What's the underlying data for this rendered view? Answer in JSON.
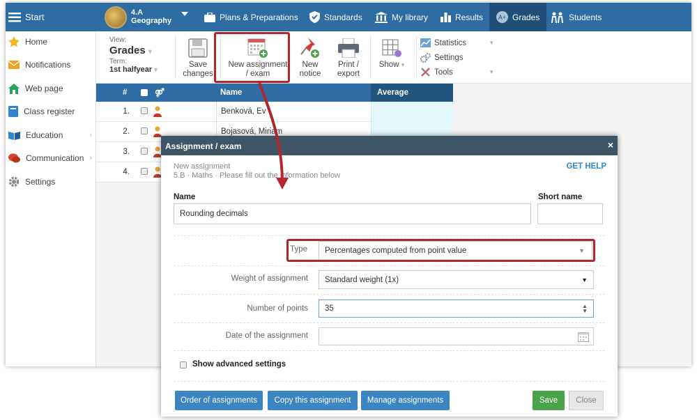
{
  "topbar": {
    "start_label": "Start",
    "class_name": "4.A",
    "subject": "Geography",
    "nav": [
      {
        "label": "Plans & Preparations",
        "icon": "briefcase-icon"
      },
      {
        "label": "Standards",
        "icon": "shield-check-icon"
      },
      {
        "label": "My library",
        "icon": "library-icon"
      },
      {
        "label": "Results",
        "icon": "bar-chart-icon"
      },
      {
        "label": "Grades",
        "icon": "grades-icon",
        "active": true
      },
      {
        "label": "Students",
        "icon": "students-icon"
      }
    ]
  },
  "sidebar": {
    "items": [
      {
        "label": "Home",
        "icon": "star-icon",
        "chevron": false
      },
      {
        "label": "Notifications",
        "icon": "envelope-icon",
        "chevron": false
      },
      {
        "label": "Web page",
        "icon": "house-icon",
        "chevron": false
      },
      {
        "label": "Class register",
        "icon": "book-icon",
        "chevron": false
      },
      {
        "label": "Education",
        "icon": "open-book-icon",
        "chevron": true
      },
      {
        "label": "Communication",
        "icon": "chat-icon",
        "chevron": true
      },
      {
        "label": "Settings",
        "icon": "gear-icon",
        "chevron": false
      }
    ]
  },
  "ribbon": {
    "view_label": "View:",
    "view_value": "Grades",
    "term_label": "Term:",
    "term_value": "1st halfyear",
    "save_line1": "Save",
    "save_line2": "changes",
    "new_line1": "New assignment",
    "new_line2": "/ exam",
    "notice_line1": "New",
    "notice_line2": "notice",
    "print_line1": "Print /",
    "print_line2": "export",
    "show_label": "Show",
    "menu": [
      "Statistics",
      "Settings",
      "Tools"
    ]
  },
  "table": {
    "headers": {
      "num": "#",
      "name": "Name",
      "average": "Average"
    },
    "rows": [
      {
        "num": "1.",
        "name": "Benková, Ev"
      },
      {
        "num": "2.",
        "name": "Bojasová, Miriam"
      },
      {
        "num": "3.",
        "name": ""
      },
      {
        "num": "4.",
        "name": ""
      }
    ]
  },
  "dialog": {
    "title": "Assignment / exam",
    "close": "×",
    "subtitle1": "New assignment",
    "subtitle2": "5.B · Maths · Please fill out the information below",
    "help": "GET HELP",
    "name_label": "Name",
    "name_value": "Rounding decimals",
    "short_label": "Short name",
    "short_value": "",
    "type_label": "Type",
    "type_value": "Percentages computed from point value",
    "weight_label": "Weight of assignment",
    "weight_value": "Standard weight (1x)",
    "points_label": "Number of points",
    "points_value": "35",
    "date_label": "Date of the assignment",
    "date_value": "",
    "advanced_label": "Show advanced settings",
    "btn_order": "Order of assignments",
    "btn_copy": "Copy this assignment",
    "btn_manage": "Manage assignments",
    "btn_save": "Save",
    "btn_close": "Close"
  },
  "colors": {
    "topbar": "#2d6da3",
    "active_tab": "#1f4f78",
    "dialog_header": "#3e5566",
    "highlight": "#b3262d",
    "save_green": "#4aa34a",
    "button_blue": "#3a85c2"
  }
}
